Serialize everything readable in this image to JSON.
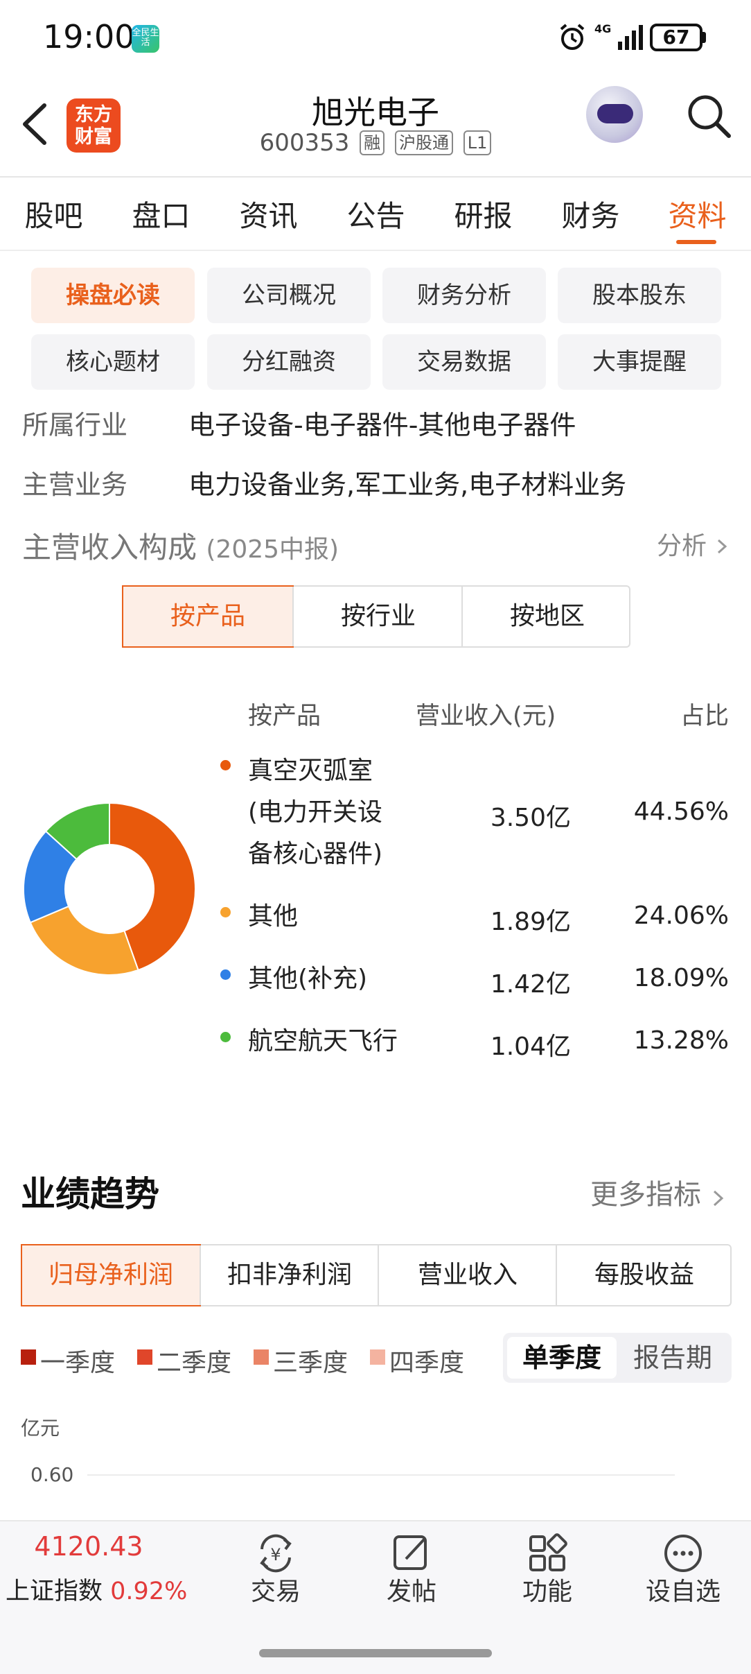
{
  "status_bar": {
    "time": "19:00",
    "app_icon_text": "全民生活",
    "network": "4G",
    "battery": "67"
  },
  "header": {
    "brand_logo": "东方财富",
    "stock_name": "旭光电子",
    "stock_code": "600353",
    "tags": [
      "融",
      "沪股通",
      "L1"
    ]
  },
  "tabs": [
    "股吧",
    "盘口",
    "资讯",
    "公告",
    "研报",
    "财务",
    "资料"
  ],
  "active_tab": "资料",
  "subtabs": [
    "操盘必读",
    "公司概况",
    "财务分析",
    "股本股东",
    "核心题材",
    "分红融资",
    "交易数据",
    "大事提醒"
  ],
  "active_subtab": "操盘必读",
  "info": {
    "industry_label": "所属行业",
    "industry_value": "电子设备-电子器件-其他电子器件",
    "business_label": "主营业务",
    "business_value": "电力设备业务,军工业务,电子材料业务"
  },
  "revenue": {
    "title": "主营收入构成",
    "period": "(2025中报)",
    "analysis_link": "分析",
    "segments": [
      "按产品",
      "按行业",
      "按地区"
    ],
    "active_segment": "按产品",
    "table_headers": [
      "按产品",
      "营业收入(元)",
      "占比"
    ],
    "rows": [
      {
        "name_lines": [
          "真空灭弧室",
          "(电力开关设",
          "备核心器件)"
        ],
        "value": "3.50亿",
        "pct": "44.56%",
        "color": "#e8590c"
      },
      {
        "name_lines": [
          "其他"
        ],
        "value": "1.89亿",
        "pct": "24.06%",
        "color": "#f7a22e"
      },
      {
        "name_lines": [
          "其他(补充)"
        ],
        "value": "1.42亿",
        "pct": "18.09%",
        "color": "#2f80e6"
      },
      {
        "name_lines": [
          "航空航天飞行"
        ],
        "value": "1.04亿",
        "pct": "13.28%",
        "color": "#4cbb3c"
      }
    ]
  },
  "chart_data": {
    "type": "pie",
    "labels": [
      "真空灭弧室(电力开关设备核心器件)",
      "其他",
      "其他(补充)",
      "航空航天飞行"
    ],
    "values": [
      44.56,
      24.06,
      18.09,
      13.28
    ],
    "colors": [
      "#e8590c",
      "#f7a22e",
      "#2f80e6",
      "#4cbb3c"
    ]
  },
  "performance": {
    "title": "业绩趋势",
    "more_link": "更多指标",
    "metrics": [
      "归母净利润",
      "扣非净利润",
      "营业收入",
      "每股收益"
    ],
    "active_metric": "归母净利润",
    "legend": [
      {
        "label": "一季度",
        "color": "#b8200e"
      },
      {
        "label": "二季度",
        "color": "#e0462a"
      },
      {
        "label": "三季度",
        "color": "#ea8466"
      },
      {
        "label": "四季度",
        "color": "#f4b3a0"
      }
    ],
    "period_options": [
      "单季度",
      "报告期"
    ],
    "active_period": "单季度",
    "unit": "亿元",
    "y_tick": "0.60"
  },
  "bottom_bar": {
    "index_value": "4120.43",
    "index_name": "上证指数",
    "index_change": "0.92%",
    "nav": [
      {
        "label": "交易",
        "icon": "trade-icon"
      },
      {
        "label": "发帖",
        "icon": "post-icon"
      },
      {
        "label": "功能",
        "icon": "grid-icon"
      },
      {
        "label": "设自选",
        "icon": "more-icon"
      }
    ]
  }
}
